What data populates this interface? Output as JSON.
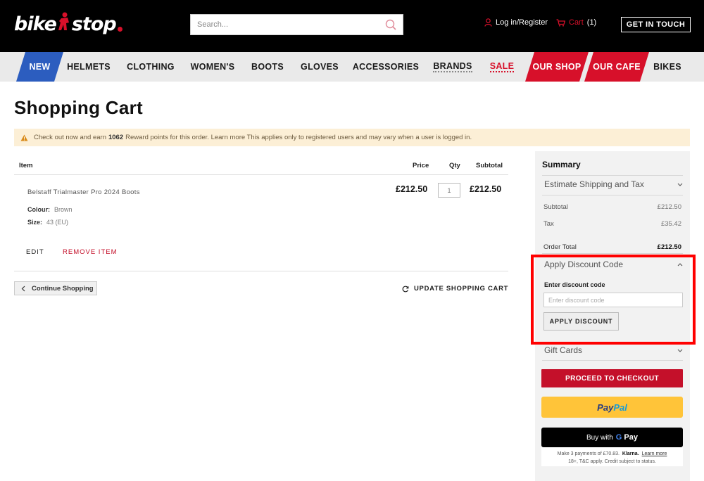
{
  "header": {
    "logo_part1": "bike",
    "logo_part2": "stop",
    "search_placeholder": "Search...",
    "login_label": "Log in/Register",
    "cart_label": "Cart",
    "cart_count": "(1)",
    "get_in_touch": "GET IN TOUCH"
  },
  "nav": {
    "items": [
      "NEW",
      "HELMETS",
      "CLOTHING",
      "WOMEN'S",
      "BOOTS",
      "GLOVES",
      "ACCESSORIES",
      "BRANDS",
      "SALE",
      "OUR SHOP",
      "OUR CAFE",
      "BIKES"
    ]
  },
  "page": {
    "title": "Shopping Cart"
  },
  "notice": {
    "prefix": "Check out now and earn",
    "points": "1062",
    "suffix": "Reward points for this order. Learn more This applies only to registered users and may vary when a user is logged in."
  },
  "cart": {
    "headers": {
      "item": "Item",
      "price": "Price",
      "qty": "Qty",
      "subtotal": "Subtotal"
    },
    "items": [
      {
        "name": "Belstaff Trialmaster Pro 2024 Boots",
        "colour_label": "Colour:",
        "colour": "Brown",
        "size_label": "Size:",
        "size": "43 (EU)",
        "price": "£212.50",
        "qty": "1",
        "subtotal": "£212.50",
        "edit_label": "EDIT",
        "remove_label": "REMOVE ITEM"
      }
    ],
    "continue_label": "Continue Shopping",
    "update_label": "UPDATE SHOPPING CART"
  },
  "summary": {
    "title": "Summary",
    "estimate_label": "Estimate Shipping and Tax",
    "subtotal_label": "Subtotal",
    "subtotal_value": "£212.50",
    "tax_label": "Tax",
    "tax_value": "£35.42",
    "order_total_label": "Order Total",
    "order_total_value": "£212.50",
    "discount_title": "Apply Discount Code",
    "discount_field_label": "Enter discount code",
    "discount_placeholder": "Enter discount code",
    "apply_label": "APPLY DISCOUNT",
    "gift_cards_label": "Gift Cards",
    "checkout_label": "PROCEED TO CHECKOUT",
    "paypal_part1": "Pay",
    "paypal_part2": "Pal",
    "gpay_prefix": "Buy with",
    "gpay_g": "G",
    "gpay_pay": "Pay",
    "klarna_prefix": "Make 3 payments of £70.83.",
    "klarna_brand": "Klarna.",
    "klarna_learn": "Learn more",
    "klarna_terms": "18+, T&C apply. Credit subject to status."
  },
  "colors": {
    "brand_red": "#d7102a",
    "nav_new_blue": "#2c5dbf",
    "highlight": "#ff0000"
  }
}
